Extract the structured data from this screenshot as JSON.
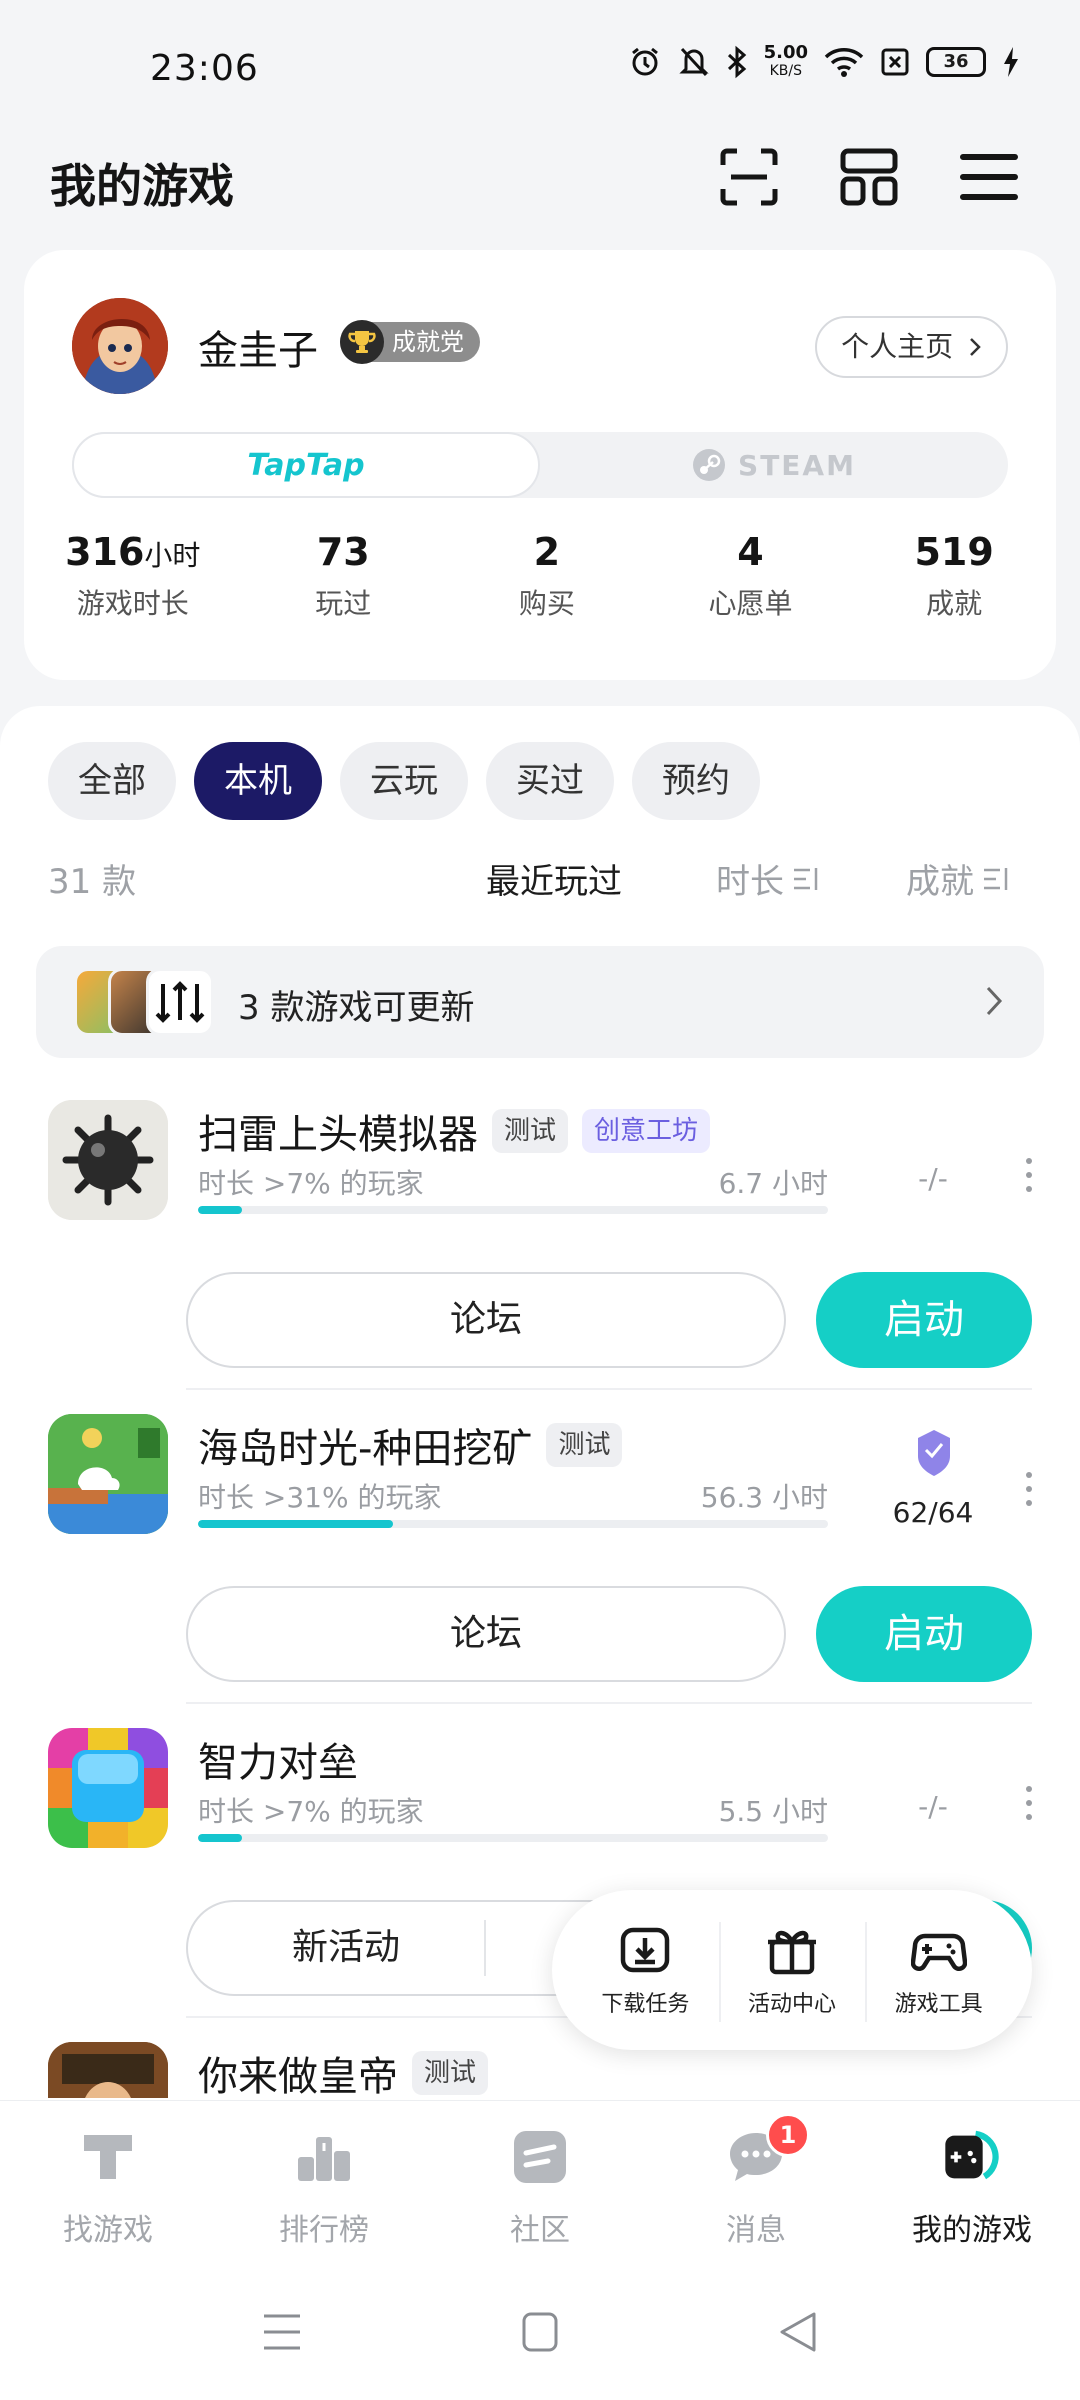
{
  "status_bar": {
    "time": "23:06",
    "net_speed_value": "5.00",
    "net_speed_unit": "KB/S",
    "battery": "36"
  },
  "header": {
    "title": "我的游戏",
    "icons": [
      "scan-icon",
      "apps-icon",
      "menu-icon"
    ]
  },
  "profile": {
    "username": "金圭子",
    "badge": "成就党",
    "profile_link": "个人主页",
    "platforms": [
      "TapTap",
      "STEAM"
    ],
    "stats": [
      {
        "value": "316",
        "unit": "小时",
        "label": "游戏时长"
      },
      {
        "value": "73",
        "unit": "",
        "label": "玩过"
      },
      {
        "value": "2",
        "unit": "",
        "label": "购买"
      },
      {
        "value": "4",
        "unit": "",
        "label": "心愿单"
      },
      {
        "value": "519",
        "unit": "",
        "label": "成就"
      }
    ]
  },
  "filters": [
    "全部",
    "本机",
    "云玩",
    "买过",
    "预约"
  ],
  "active_filter": "本机",
  "list_header": {
    "count": "31 款",
    "sorts": [
      "最近玩过",
      "时长",
      "成就"
    ]
  },
  "update_banner": {
    "text": "3 款游戏可更新"
  },
  "games": [
    {
      "title": "扫雷上头模拟器",
      "tags": [
        "测试",
        "创意工坊"
      ],
      "rank": "时长 >7% 的玩家",
      "playtime": "6.7 小时",
      "progress": 0.07,
      "achievement": "-/-",
      "buttons": [
        "论坛",
        "启动"
      ]
    },
    {
      "title": "海岛时光-种田挖矿",
      "tags": [
        "测试"
      ],
      "rank": "时长 >31% 的玩家",
      "playtime": "56.3 小时",
      "progress": 0.31,
      "achievement": "62/64",
      "buttons": [
        "论坛",
        "启动"
      ]
    },
    {
      "title": "智力对垒",
      "tags": [],
      "rank": "时长 >7% 的玩家",
      "playtime": "5.5 小时",
      "progress": 0.07,
      "achievement": "-/-",
      "buttons": [
        "新活动"
      ]
    },
    {
      "title": "你来做皇帝",
      "tags": [
        "测试"
      ]
    }
  ],
  "floating_menu": [
    "下载任务",
    "活动中心",
    "游戏工具"
  ],
  "bottom_nav": [
    {
      "label": "找游戏",
      "icon": "discover-icon"
    },
    {
      "label": "排行榜",
      "icon": "ranking-icon"
    },
    {
      "label": "社区",
      "icon": "community-icon"
    },
    {
      "label": "消息",
      "icon": "message-icon",
      "badge": "1"
    },
    {
      "label": "我的游戏",
      "icon": "my-games-icon"
    }
  ],
  "colors": {
    "accent": "#15CFC6",
    "active_chip": "#1C1A66",
    "badge_red": "#FF4D4D"
  }
}
